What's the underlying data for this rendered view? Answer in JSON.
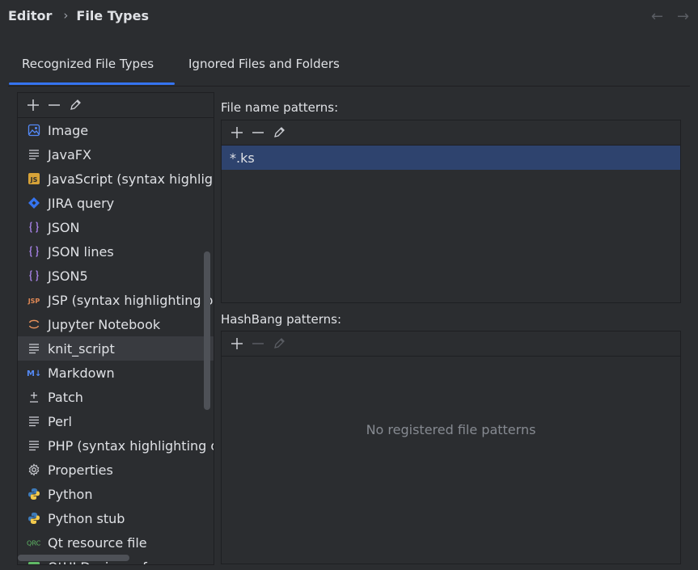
{
  "breadcrumb": {
    "parent": "Editor",
    "separator": "›",
    "current": "File Types"
  },
  "nav": {
    "back": "←",
    "forward": "→"
  },
  "tabs": [
    {
      "label": "Recognized File Types",
      "active": true
    },
    {
      "label": "Ignored Files and Folders",
      "active": false
    }
  ],
  "file_types": {
    "toolbar": {
      "add": "add-icon",
      "remove": "remove-icon",
      "edit": "edit-icon"
    },
    "items": [
      {
        "label": "Image",
        "icon": "image-icon",
        "selected": false
      },
      {
        "label": "JavaFX",
        "icon": "text-lines-icon",
        "selected": false
      },
      {
        "label": "JavaScript (syntax highlighting only)",
        "icon": "javascript-icon",
        "selected": false
      },
      {
        "label": "JIRA query",
        "icon": "jira-icon",
        "selected": false
      },
      {
        "label": "JSON",
        "icon": "json-icon",
        "selected": false
      },
      {
        "label": "JSON lines",
        "icon": "json-icon",
        "selected": false
      },
      {
        "label": "JSON5",
        "icon": "json-icon",
        "selected": false
      },
      {
        "label": "JSP (syntax highlighting only)",
        "icon": "jsp-icon",
        "selected": false
      },
      {
        "label": "Jupyter Notebook",
        "icon": "jupyter-icon",
        "selected": false
      },
      {
        "label": "knit_script",
        "icon": "text-lines-icon",
        "selected": true
      },
      {
        "label": "Markdown",
        "icon": "markdown-icon",
        "selected": false
      },
      {
        "label": "Patch",
        "icon": "patch-icon",
        "selected": false
      },
      {
        "label": "Perl",
        "icon": "text-lines-icon",
        "selected": false
      },
      {
        "label": "PHP (syntax highlighting only)",
        "icon": "text-lines-icon",
        "selected": false
      },
      {
        "label": "Properties",
        "icon": "gear-icon",
        "selected": false
      },
      {
        "label": "Python",
        "icon": "python-icon",
        "selected": false
      },
      {
        "label": "Python stub",
        "icon": "python-icon",
        "selected": false
      },
      {
        "label": "Qt resource file",
        "icon": "qrc-icon",
        "selected": false
      },
      {
        "label": "QtUI Designer form",
        "icon": "qtui-icon",
        "selected": false
      }
    ]
  },
  "file_name_patterns": {
    "label": "File name patterns:",
    "patterns": [
      "*.ks"
    ]
  },
  "hashbang_patterns": {
    "label": "HashBang patterns:",
    "empty_text": "No registered file patterns"
  },
  "colors": {
    "background": "#2b2d30",
    "accent": "#3574f0",
    "selection": "#2e436e",
    "text": "#dfe1e5"
  }
}
